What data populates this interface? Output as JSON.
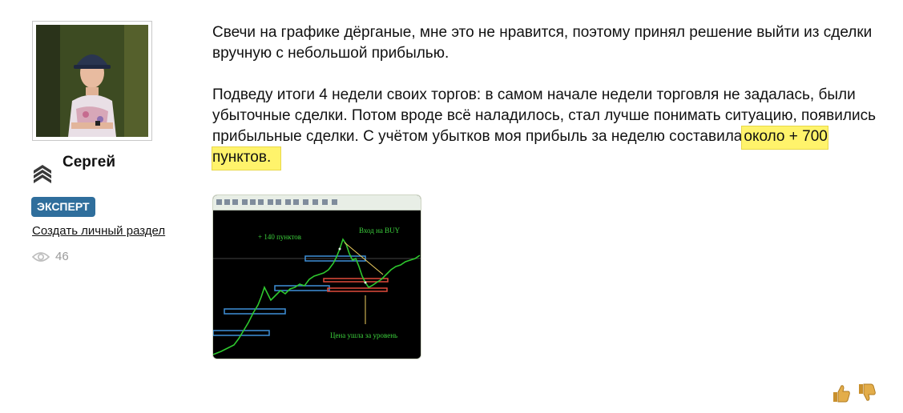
{
  "user": {
    "name": "Сергей",
    "badge": "ЭКСПЕРТ",
    "create_section_link": "Создать личный раздел",
    "views": "46"
  },
  "post": {
    "paragraph1": "Свечи на графике дёрганые, мне это не нравится, поэтому принял решение выйти из сделки вручную с небольшой прибылью.",
    "paragraph2_main": "Подведу итоги 4 недели своих торгов: в самом начале недели торговля не задалась, были убыточные сделки. Потом вроде всё наладилось, стал лучше понимать ситуацию, появились прибыльные сделки. С учётом убытков моя прибыль за неделю составила",
    "paragraph2_highlight": "около + 700 пунктов."
  },
  "screenshot_labels": {
    "profit": "+ 140 пунктов",
    "entry": "Вход на BUY",
    "level": "Цена ушла за уровень"
  },
  "icons": {
    "rank": "chevron-rank-icon",
    "views": "eye-icon",
    "like": "thumbs-up-icon",
    "dislike": "thumbs-down-icon"
  },
  "colors": {
    "badge": "#2f6e9c",
    "highlight": "#fff36b",
    "chart_text": "#3ccf3c"
  }
}
